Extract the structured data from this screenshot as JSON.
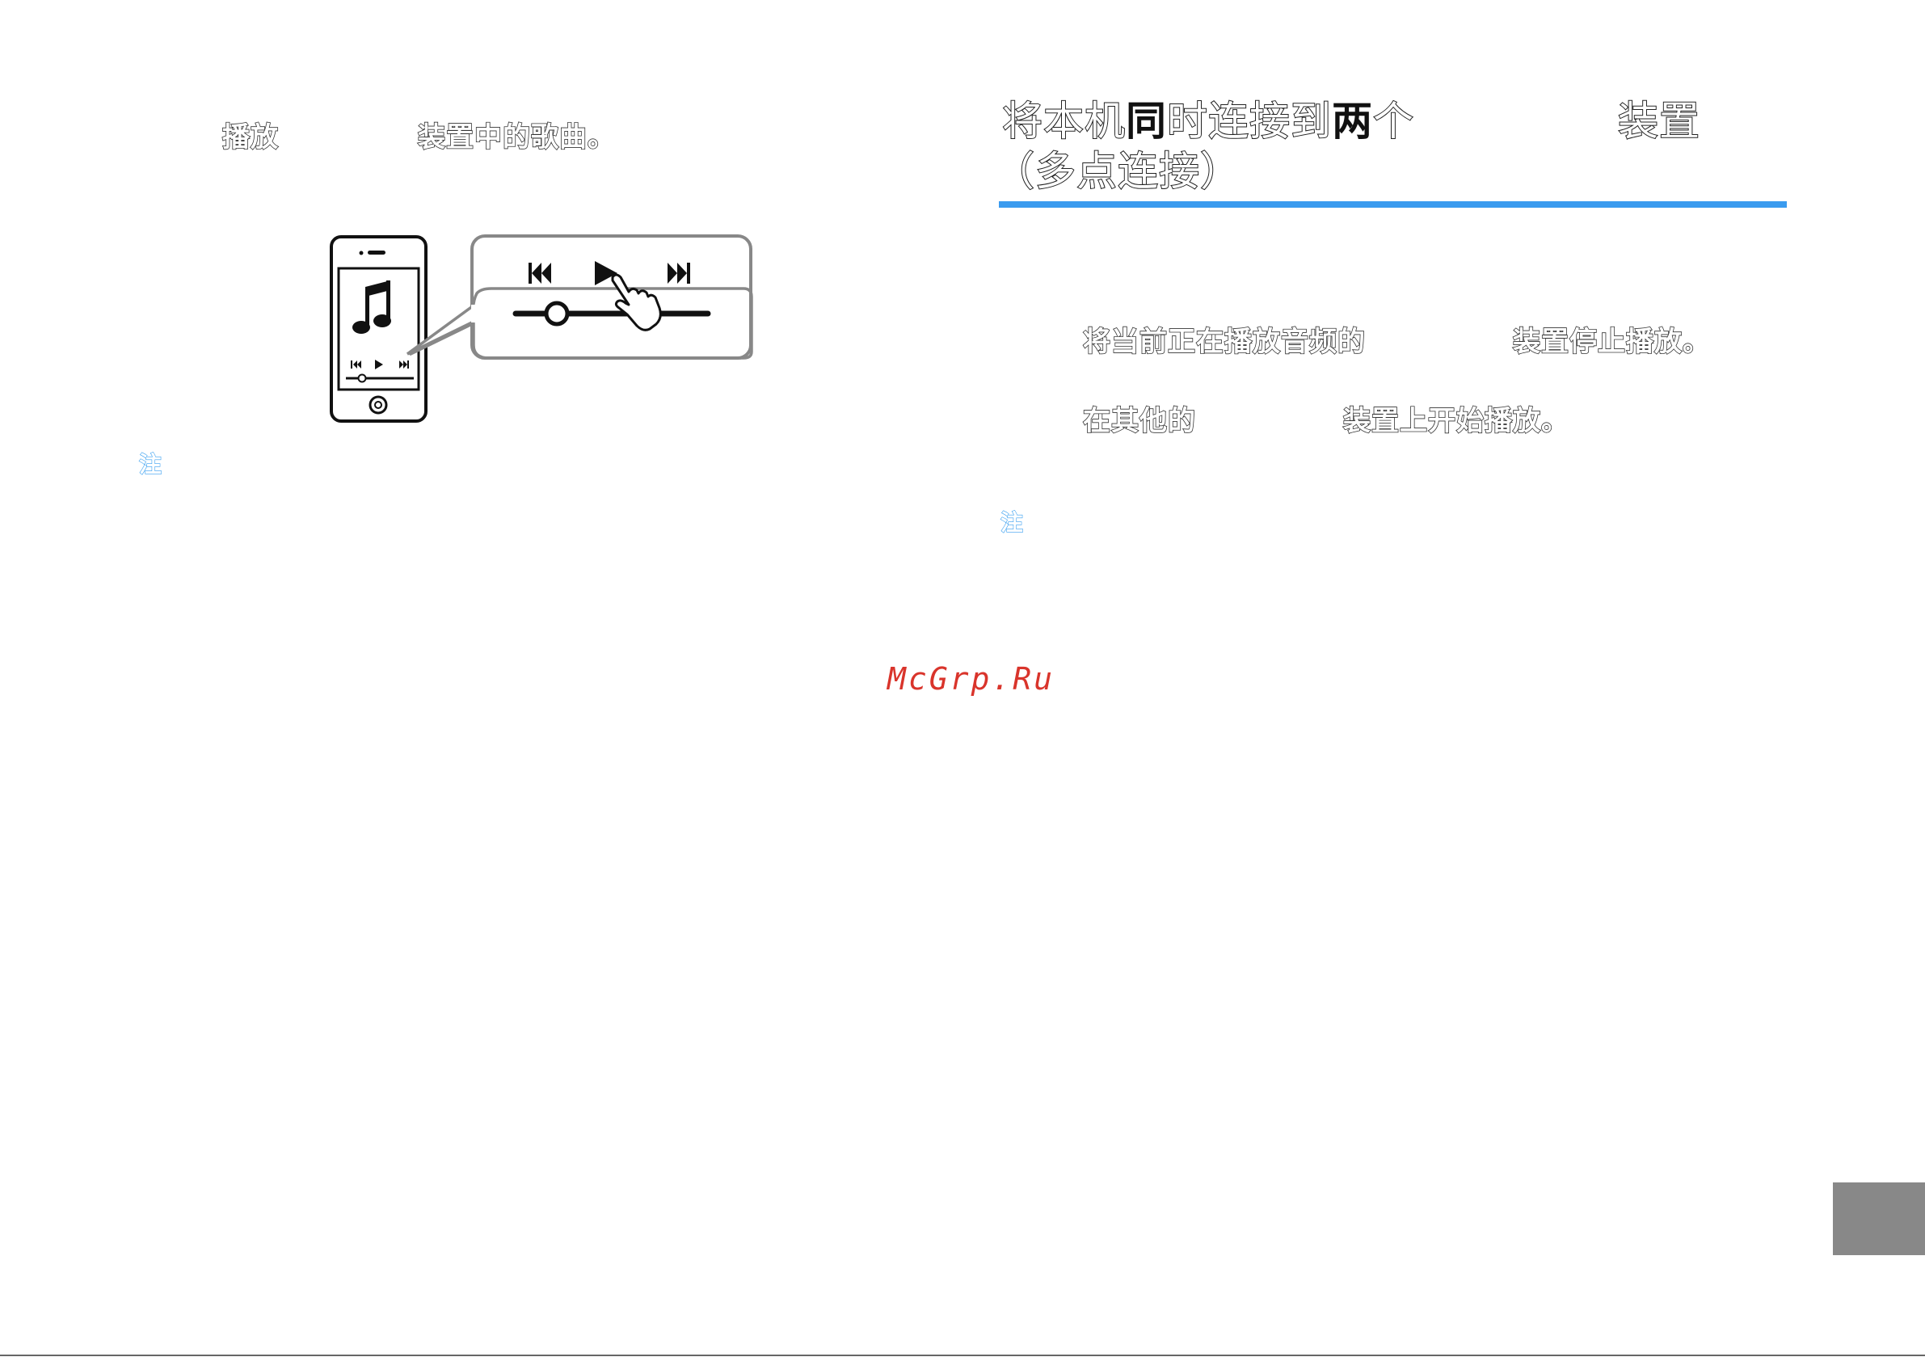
{
  "left": {
    "step": {
      "part1": "播放",
      "part2": "装置中的歌曲。"
    },
    "note_label": "注"
  },
  "right": {
    "heading": {
      "line1_a": "将本机",
      "line1_b": "同",
      "line1_c": "时连接到",
      "line1_d": "两",
      "line1_e": "个",
      "line1_f": "装置",
      "line2": "（多点连接）"
    },
    "step1": {
      "part1": "将当前正在播放音频的",
      "part2": "装置停止播放。"
    },
    "step2": {
      "part1": "在其他的",
      "part2": "装置上开始播放。"
    },
    "note_label": "注"
  },
  "watermark": "McGrp.Ru",
  "colors": {
    "accent": "#3a9bef",
    "watermark": "#d9342b",
    "tab": "#888888"
  },
  "icons": [
    "phone-icon",
    "music-note-icon",
    "previous-track-icon",
    "play-icon",
    "next-track-icon",
    "hand-pointer-icon",
    "seek-slider"
  ]
}
